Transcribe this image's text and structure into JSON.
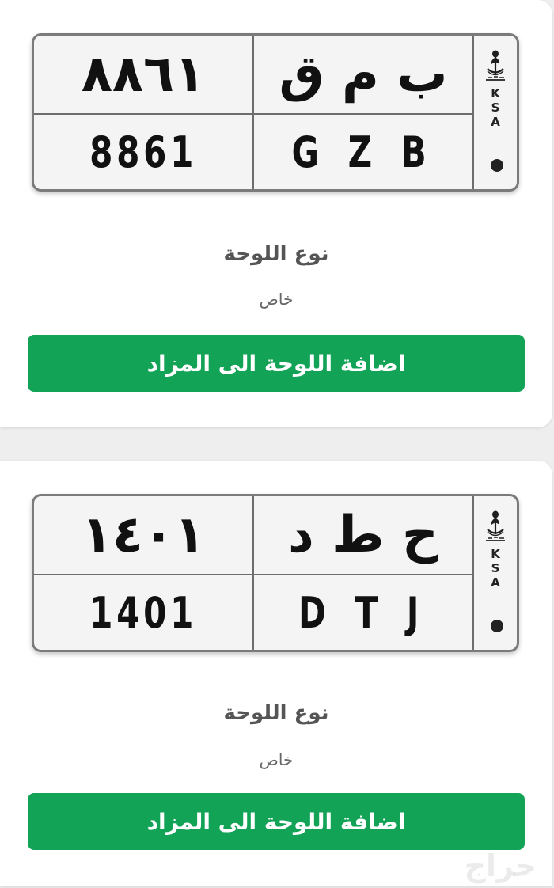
{
  "listings": [
    {
      "plate": {
        "numbers_ar": "٨٨٦١",
        "letters_ar": "ب م ق",
        "numbers_en": "8861",
        "letters_en": "G Z B",
        "country": [
          "K",
          "S",
          "A"
        ]
      },
      "type_label": "نوع اللوحة",
      "type_value": "خاص",
      "add_button_label": "اضافة اللوحة الى المزاد"
    },
    {
      "plate": {
        "numbers_ar": "١٤٠١",
        "letters_ar": "ح ط د",
        "numbers_en": "1401",
        "letters_en": "D T J",
        "country": [
          "K",
          "S",
          "A"
        ]
      },
      "type_label": "نوع اللوحة",
      "type_value": "خاص",
      "add_button_label": "اضافة اللوحة الى المزاد"
    }
  ],
  "watermark": "حراج",
  "colors": {
    "button_bg": "#12a356",
    "background": "#eeeeee"
  },
  "icons": {
    "emblem": "saudi-emblem-icon"
  }
}
